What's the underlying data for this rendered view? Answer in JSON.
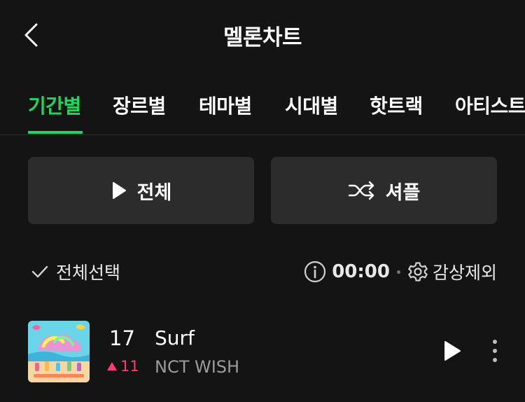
{
  "header": {
    "title": "멜론차트",
    "back_icon": "chevron-left-icon"
  },
  "tabs": [
    {
      "label": "기간별",
      "active": true
    },
    {
      "label": "장르별",
      "active": false
    },
    {
      "label": "테마별",
      "active": false
    },
    {
      "label": "시대별",
      "active": false
    },
    {
      "label": "핫트랙",
      "active": false
    },
    {
      "label": "아티스트",
      "active": false
    }
  ],
  "actions": {
    "play_all_label": "전체",
    "shuffle_label": "셔플"
  },
  "selection_bar": {
    "select_all_label": "전체선택",
    "timer": "00:00",
    "exclude_label": "감상제외"
  },
  "chart": {
    "rows": [
      {
        "rank": "17",
        "change": "11",
        "change_direction": "up",
        "title": "Surf",
        "artist": "NCT WISH"
      }
    ]
  },
  "colors": {
    "accent": "#1ed760",
    "rank_up": "#ff3c6e",
    "background": "#141414",
    "button_bg": "#2c2c2c"
  }
}
